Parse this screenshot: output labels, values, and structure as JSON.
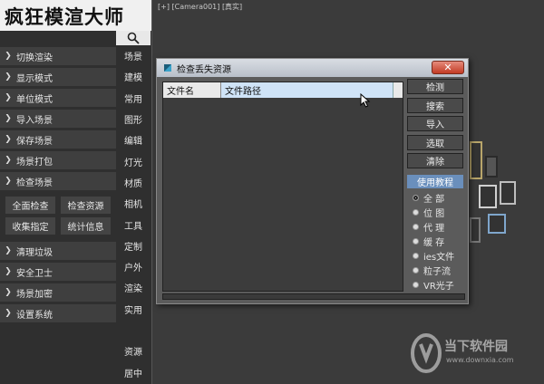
{
  "app": {
    "title": "疯狂模渲大师"
  },
  "menu": {
    "items": [
      {
        "label": "切换渲染"
      },
      {
        "label": "显示模式"
      },
      {
        "label": "单位模式"
      },
      {
        "label": "导入场景"
      },
      {
        "label": "保存场景"
      },
      {
        "label": "场景打包"
      },
      {
        "label": "检查场景"
      }
    ],
    "sub_buttons": [
      {
        "label": "全面检查"
      },
      {
        "label": "检查资源"
      },
      {
        "label": "收集指定"
      },
      {
        "label": "统计信息"
      }
    ],
    "items_after": [
      {
        "label": "清理垃圾"
      },
      {
        "label": "安全卫士"
      },
      {
        "label": "场景加密"
      },
      {
        "label": "设置系统"
      }
    ]
  },
  "side_tabs": [
    "场景",
    "建模",
    "常用",
    "图形",
    "编辑",
    "灯光",
    "材质",
    "相机",
    "工具",
    "定制",
    "户外",
    "渲染",
    "实用",
    "",
    "资源",
    "居中"
  ],
  "viewport": {
    "label": "[+] [Camera001] [真实]"
  },
  "dialog": {
    "title": "检查丢失资源",
    "close_label": "✕",
    "columns": [
      "文件名",
      "文件路径"
    ],
    "buttons": [
      "检测",
      "搜索",
      "导入",
      "选取",
      "清除"
    ],
    "tutorial_label": "使用教程",
    "filters": [
      {
        "label": "全  部",
        "selected": true
      },
      {
        "label": "位  图",
        "selected": false
      },
      {
        "label": "代  理",
        "selected": false
      },
      {
        "label": "缓  存",
        "selected": false
      },
      {
        "label": "ies文件",
        "selected": false
      },
      {
        "label": "粒子流",
        "selected": false
      },
      {
        "label": "VR光子",
        "selected": false
      }
    ]
  },
  "watermark": {
    "title": "当下软件园",
    "url": "www.downxia.com"
  },
  "colors": {
    "accent": "#6a8fbc",
    "close": "#c23b24"
  }
}
